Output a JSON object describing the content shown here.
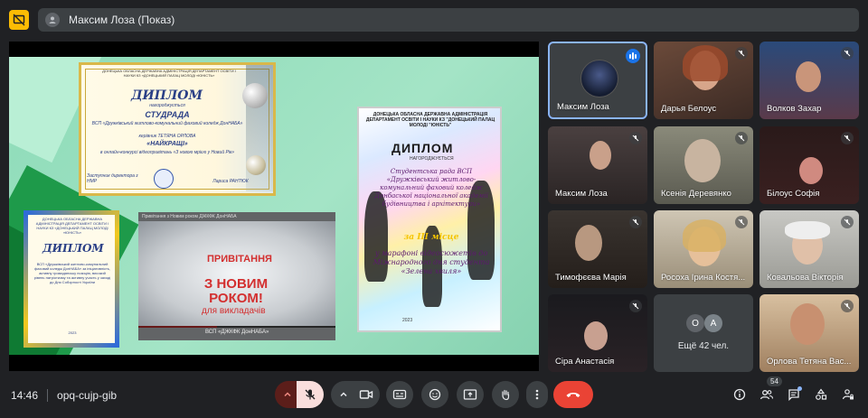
{
  "top_bar": {
    "presenter_label": "Максим Лоза (Показ)"
  },
  "shared_screen": {
    "diploma_top_left": {
      "header": "ДОНЕЦЬКА ОБЛАСНА ДЕРЖАВНА АДМІНІСТРАЦІЯ ДЕПАРТАМЕНТ ОСВІТИ І НАУКИ КЗ «ДОНЕЦЬКИЙ ПАЛАЦ МОЛОДІ «ЮНІСТЬ»",
      "title": "ДИПЛОМ",
      "awarded": "нагороджується",
      "name": "СТУДРАДА",
      "org": "ВСП «Дружківський житлово-комунальний фаховий коледж ДонНАБА»",
      "leader": "керівник ТЕТЯНА ОРЛОВА",
      "category": "«НАЙКРАЩІ»",
      "contest": "в онлайн-конкурсі відеопривітань «З новою мрією у Новий Рік»",
      "sign_left": "Заступник директора з НМР",
      "sign_right": "Лариса РАНТЮК"
    },
    "diploma_bottom_left": {
      "header": "ДОНЕЦЬКА ОБЛАСНА ДЕРЖАВНА АДМІНІСТРАЦІЯ ДЕПАРТАМЕНТ ОСВІТИ І НАУКИ КЗ «ДОНЕЦЬКИЙ ПАЛАЦ МОЛОДІ «ЮНІСТЬ»",
      "title": "ДИПЛОМ",
      "text": "ВСП «Дружківський житлово-комунальний фаховий коледж ДонНАБА» за ініціативність, активну громадянську позицію, високий рівень патріотизму та активну участь у заході до Дня Соборності України",
      "year": "2023"
    },
    "video": {
      "top_title": "Привітання з Новим роком ДЖКФК ДонНАБА",
      "line1": "ПРИВІТАННЯ",
      "line2": "З НОВИМ РОКОМ!",
      "line3": "для викладачів",
      "caption": "ВСП «ДЖКФК ДонНАБА»"
    },
    "diploma_right": {
      "header": "ДОНЕЦЬКА ОБЛАСНА ДЕРЖАВНА АДМІНІСТРАЦІЯ ДЕПАРТАМЕНТ ОСВІТИ І НАУКИ КЗ \"ДОНЕЦЬКИЙ ПАЛАЦ МОЛОДІ \"ЮНІСТЬ\"",
      "title": "ДИПЛОМ",
      "awarded": "НАГОРОДЖУЄТЬСЯ",
      "line1": "Студентська рада ВСП «Дружківський житлово-комунальний фаховий коледж Донбаської національної академії будівництва і архітектури»",
      "line2": "за ІІІ місце",
      "line3": "у марафоні відеосюжетів до Міжнародного дня студента «Зелена хвиля»",
      "year": "2023"
    }
  },
  "participants": [
    {
      "name": "Максим Лоза",
      "state": "speaking"
    },
    {
      "name": "Дарья Белоус",
      "state": "muted"
    },
    {
      "name": "Волков Захар",
      "state": "muted"
    },
    {
      "name": "Максим Лоза",
      "state": "muted"
    },
    {
      "name": "Ксенія Деревянко",
      "state": "muted"
    },
    {
      "name": "Білоус Софія",
      "state": "muted"
    },
    {
      "name": "Тимофєєва Марія",
      "state": "muted"
    },
    {
      "name": "Росоха Ірина Костя...",
      "state": "muted"
    },
    {
      "name": "Ковальова Вікторія",
      "state": "muted"
    },
    {
      "name": "Сіра Анастасія",
      "state": "muted"
    },
    {
      "name": "Орлова Тетяна Вас...",
      "state": "muted"
    }
  ],
  "more_tile": {
    "avatar1": "O",
    "avatar2": "A",
    "label": "Ещё 42 чел."
  },
  "bottom_bar": {
    "time": "14:46",
    "meeting_code": "opq-cujp-gib",
    "participant_count": "54"
  },
  "colors": {
    "background": "#202124",
    "tile": "#3c4043",
    "end_call": "#ea4335",
    "mic_off_bg": "#f9dedc",
    "active_border": "#8ab4f8",
    "present_badge": "#fbbc04"
  }
}
